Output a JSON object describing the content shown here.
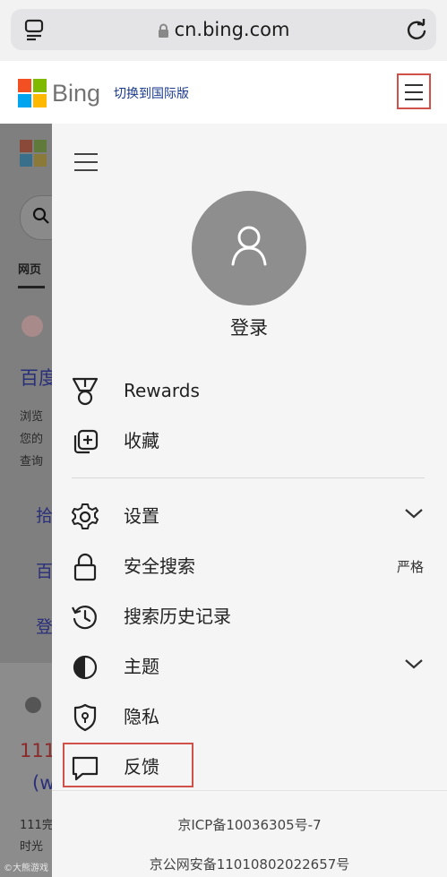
{
  "browser": {
    "url": "cn.bing.com",
    "tabs_icon": "tabs-icon",
    "lock_icon": "lock-icon",
    "reload_icon": "reload-icon"
  },
  "header": {
    "brand": "Bing",
    "switch_link": "切换到国际版",
    "menu_icon": "hamburger-menu-icon",
    "highlight_color": "#d0504a"
  },
  "background_page": {
    "tab": "网页",
    "snippets": [
      "百度",
      "浏览",
      "您的",
      "查询",
      "拾",
      "百",
      "登",
      "111",
      "(w",
      "111完",
      "时光"
    ]
  },
  "drawer": {
    "login_label": "登录",
    "items_top": [
      {
        "icon": "rewards-medal-icon",
        "label": "Rewards"
      },
      {
        "icon": "favorites-add-icon",
        "label": "收藏"
      }
    ],
    "items_bottom": [
      {
        "icon": "gear-icon",
        "label": "设置",
        "chevron": true
      },
      {
        "icon": "lock-icon",
        "label": "安全搜索",
        "value": "严格"
      },
      {
        "icon": "history-icon",
        "label": "搜索历史记录"
      },
      {
        "icon": "theme-contrast-icon",
        "label": "主题",
        "chevron": true
      },
      {
        "icon": "privacy-shield-icon",
        "label": "隐私"
      },
      {
        "icon": "feedback-icon",
        "label": "反馈"
      }
    ],
    "footer": [
      "京ICP备10036305号-7",
      "京公网安备11010802022657号"
    ]
  },
  "watermark": "©大熊游戏"
}
